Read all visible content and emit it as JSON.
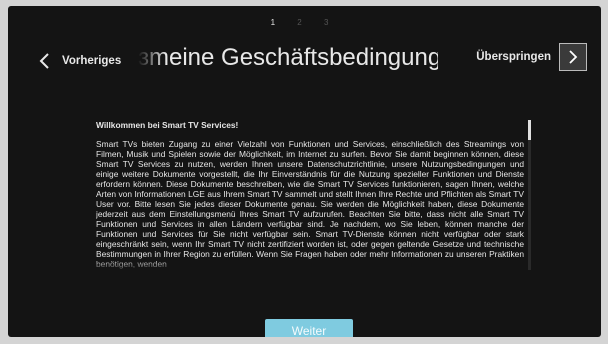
{
  "pager": {
    "pages": [
      "1",
      "2",
      "3"
    ],
    "current": "1"
  },
  "nav": {
    "back_label": "Vorheriges",
    "skip_label": "Überspringen"
  },
  "title": "ɜmeine Geschäftsbedingungen",
  "terms": {
    "heading": "Willkommen bei Smart TV Services!",
    "body": "Smart TVs bieten Zugang zu einer Vielzahl von Funktionen und Services, einschließlich des Streamings von Filmen, Musik und Spielen sowie der Möglichkeit, im Internet zu surfen. Bevor Sie damit beginnen können, diese Smart TV Services zu nutzen, werden Ihnen unsere Datenschutzrichtlinie, unsere Nutzungsbedingungen und einige weitere Dokumente vorgestellt, die Ihr Einverständnis für die Nutzung spezieller Funktionen und Dienste erfordern können. Diese Dokumente beschreiben, wie die Smart TV Services funktionieren, sagen Ihnen, welche Arten von Informationen LGE aus Ihrem Smart TV sammelt und stellt Ihnen Ihre Rechte und Pflichten als Smart TV User vor. Bitte lesen Sie jedes dieser Dokumente genau. Sie werden die Möglichkeit haben, diese Dokumente jederzeit aus dem Einstellungsmenü Ihres Smart TV aufzurufen. Beachten Sie bitte, dass nicht alle Smart TV Funktionen und Services in allen Ländern verfügbar sind. Je nachdem, wo Sie leben, können manche der Funktionen und Services für Sie nicht verfügbar sein. Smart TV-Dienste können nicht verfügbar oder stark eingeschränkt sein, wenn Ihr Smart TV nicht zertifiziert worden ist, oder gegen geltende Gesetze und technische Bestimmungen in Ihrer Region zu erfüllen. Wenn Sie Fragen haben oder mehr Informationen zu unseren Praktiken benötigen, wenden"
  },
  "footer": {
    "next_label": "Weiter"
  },
  "icons": {
    "back": "chevron-left-icon",
    "skip": "chevron-right-icon"
  },
  "colors": {
    "background": "#141414",
    "accent": "#7fcbe0",
    "text": "#e6e6e6"
  }
}
